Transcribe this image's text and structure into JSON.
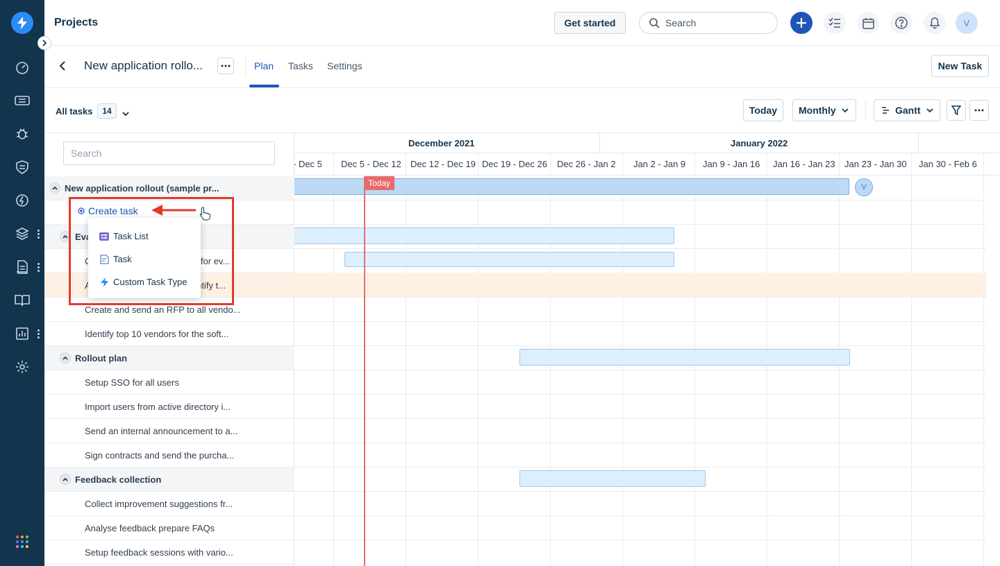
{
  "app": {
    "title": "Projects"
  },
  "topbar": {
    "get_started": "Get started",
    "search_placeholder": "Search",
    "avatar_initial": "V"
  },
  "project": {
    "name": "New application rollo...",
    "tabs": [
      {
        "label": "Plan",
        "active": true
      },
      {
        "label": "Tasks"
      },
      {
        "label": "Settings"
      }
    ],
    "new_task": "New Task"
  },
  "toolbar": {
    "all_tasks": "All tasks",
    "count": "14",
    "today": "Today",
    "view_range": "Monthly",
    "view_type": "Gantt"
  },
  "tasklist": {
    "search_placeholder": "Search",
    "rows": [
      {
        "type": "group",
        "label": "New application rollout (sample pr..."
      },
      {
        "type": "create",
        "label": ""
      },
      {
        "type": "group",
        "label": "Eva"
      },
      {
        "type": "task",
        "label": "Create a list of requirements for ev..."
      },
      {
        "type": "task",
        "label": "Analyse requirements to identify t...",
        "highlight": true
      },
      {
        "type": "task",
        "label": "Create and send an RFP to all vendo..."
      },
      {
        "type": "task",
        "label": "Identify top 10 vendors for the soft..."
      },
      {
        "type": "group",
        "label": "Rollout plan"
      },
      {
        "type": "task",
        "label": "Setup SSO for all users"
      },
      {
        "type": "task",
        "label": "Import users from active directory i..."
      },
      {
        "type": "task",
        "label": "Send an internal announcement to a..."
      },
      {
        "type": "task",
        "label": "Sign contracts and send the purcha..."
      },
      {
        "type": "group",
        "label": "Feedback collection"
      },
      {
        "type": "task",
        "label": "Collect improvement suggestions fr..."
      },
      {
        "type": "task",
        "label": "Analyse feedback prepare FAQs"
      },
      {
        "type": "task",
        "label": "Setup feedback sessions with vario..."
      }
    ]
  },
  "create_menu": {
    "create_task": "Create task",
    "items": [
      {
        "label": "Task List",
        "icon": "task-list-icon"
      },
      {
        "label": "Task",
        "icon": "task-icon"
      },
      {
        "label": "Custom Task Type",
        "icon": "lightning-icon"
      }
    ]
  },
  "gantt": {
    "months": [
      "December 2021",
      "January 2022"
    ],
    "weeks": [
      "- Dec 5",
      "Dec 5 - Dec 12",
      "Dec 12 - Dec 19",
      "Dec 19 - Dec 26",
      "Dec 26 - Jan 2",
      "Jan 2 - Jan 9",
      "Jan 9 - Jan 16",
      "Jan 16 - Jan 23",
      "Jan 23 - Jan 30",
      "Jan 30 - Feb 6"
    ],
    "today_label": "Today",
    "assignee_initial": "V"
  },
  "colors": {
    "rail": "#12344d",
    "accent": "#1e56b7",
    "today": "#e86b6b",
    "highlight": "#fef1e3",
    "annotation": "#e53a2a"
  }
}
